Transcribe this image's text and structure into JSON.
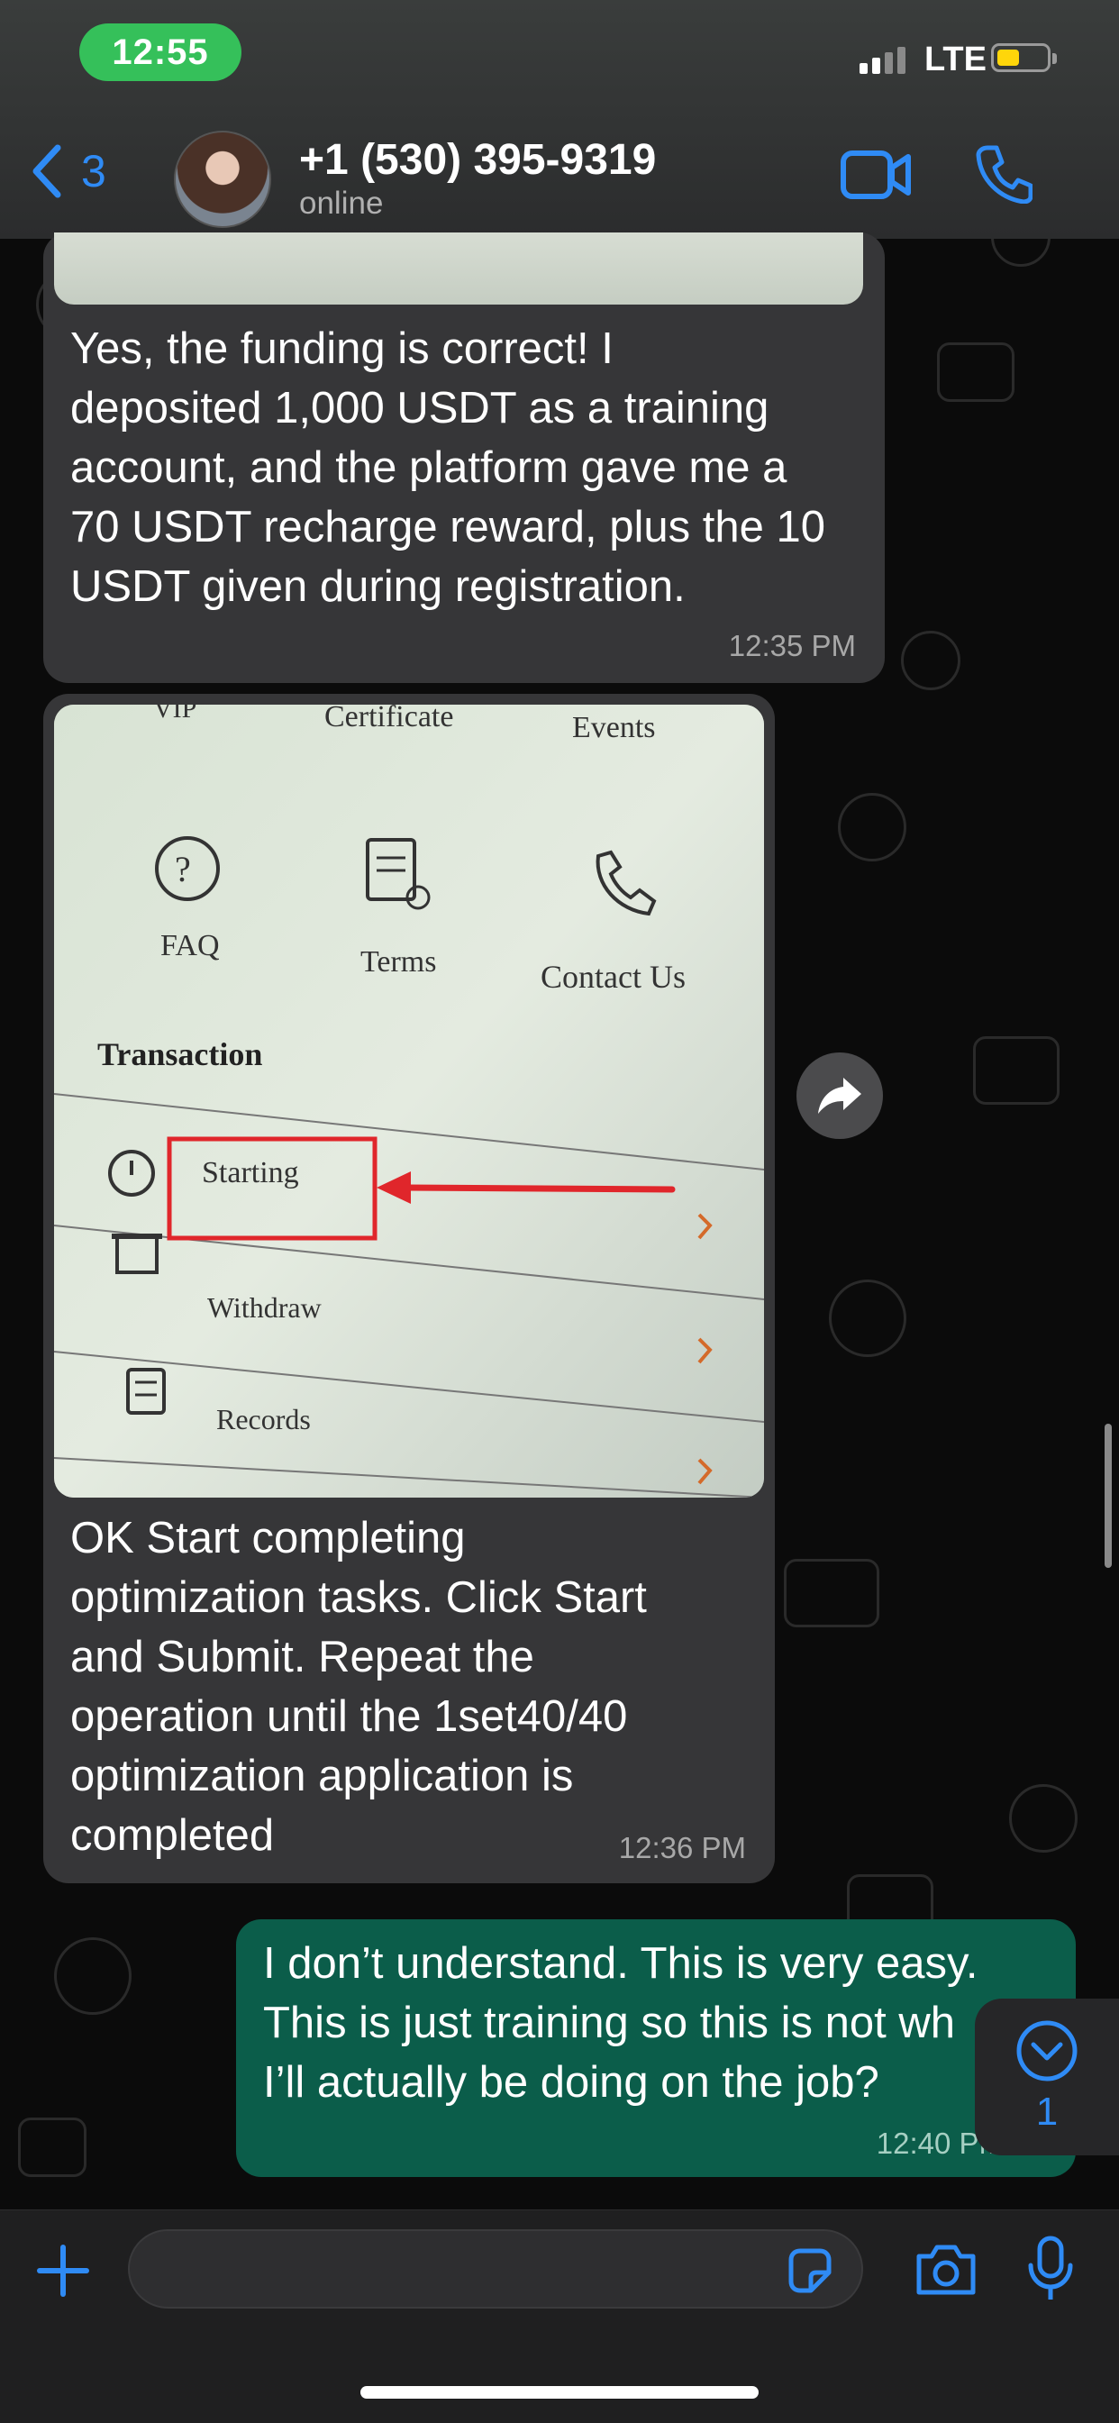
{
  "status_bar": {
    "time": "12:55",
    "network": "LTE"
  },
  "header": {
    "back_count": "3",
    "contact_name": "+1 (530) 395-9319",
    "contact_status": "online",
    "icons": [
      "chevron-left-icon",
      "video-call-icon",
      "phone-icon"
    ]
  },
  "messages": [
    {
      "direction": "incoming",
      "text_lines": [
        "Yes, the funding is correct! I",
        "deposited 1,000 USDT as a training",
        "account, and the platform gave me a",
        "70 USDT recharge reward, plus the 10",
        "USDT given during registration."
      ],
      "time": "12:35 PM"
    },
    {
      "direction": "incoming",
      "text_lines": [
        "OK Start completing",
        "optimization tasks. Click Start",
        "and Submit. Repeat the",
        "operation until the 1set40/40",
        "optimization application is",
        "completed"
      ],
      "time": "12:36 PM"
    },
    {
      "direction": "outgoing",
      "text_lines": [
        "I don’t understand. This is very easy.",
        "This is just training so this is not wh",
        "I’ll actually be doing on the job?"
      ],
      "time": "12:40 PM"
    }
  ],
  "photo": {
    "menu_top": [
      "VIP",
      "Certificate",
      "Events"
    ],
    "icons": [
      {
        "label": "FAQ",
        "icon": "question-icon"
      },
      {
        "label": "Terms",
        "icon": "document-icon"
      },
      {
        "label": "Contact Us",
        "icon": "phone-support-icon"
      }
    ],
    "section_title": "Transaction",
    "rows": [
      {
        "label": "Starting",
        "icon": "timer-icon"
      },
      {
        "label": "Withdraw",
        "icon": "wallet-icon"
      },
      {
        "label": "Records",
        "icon": "records-icon"
      }
    ],
    "highlight_color": "#e0262b"
  },
  "scroll_badge": {
    "count": "1"
  },
  "composer": {
    "placeholder": ""
  },
  "colors": {
    "accent": "#2f8bf5",
    "outgoing_bubble": "#0b5d4a",
    "incoming_bubble": "#363638",
    "time_pill": "#35c05a"
  }
}
